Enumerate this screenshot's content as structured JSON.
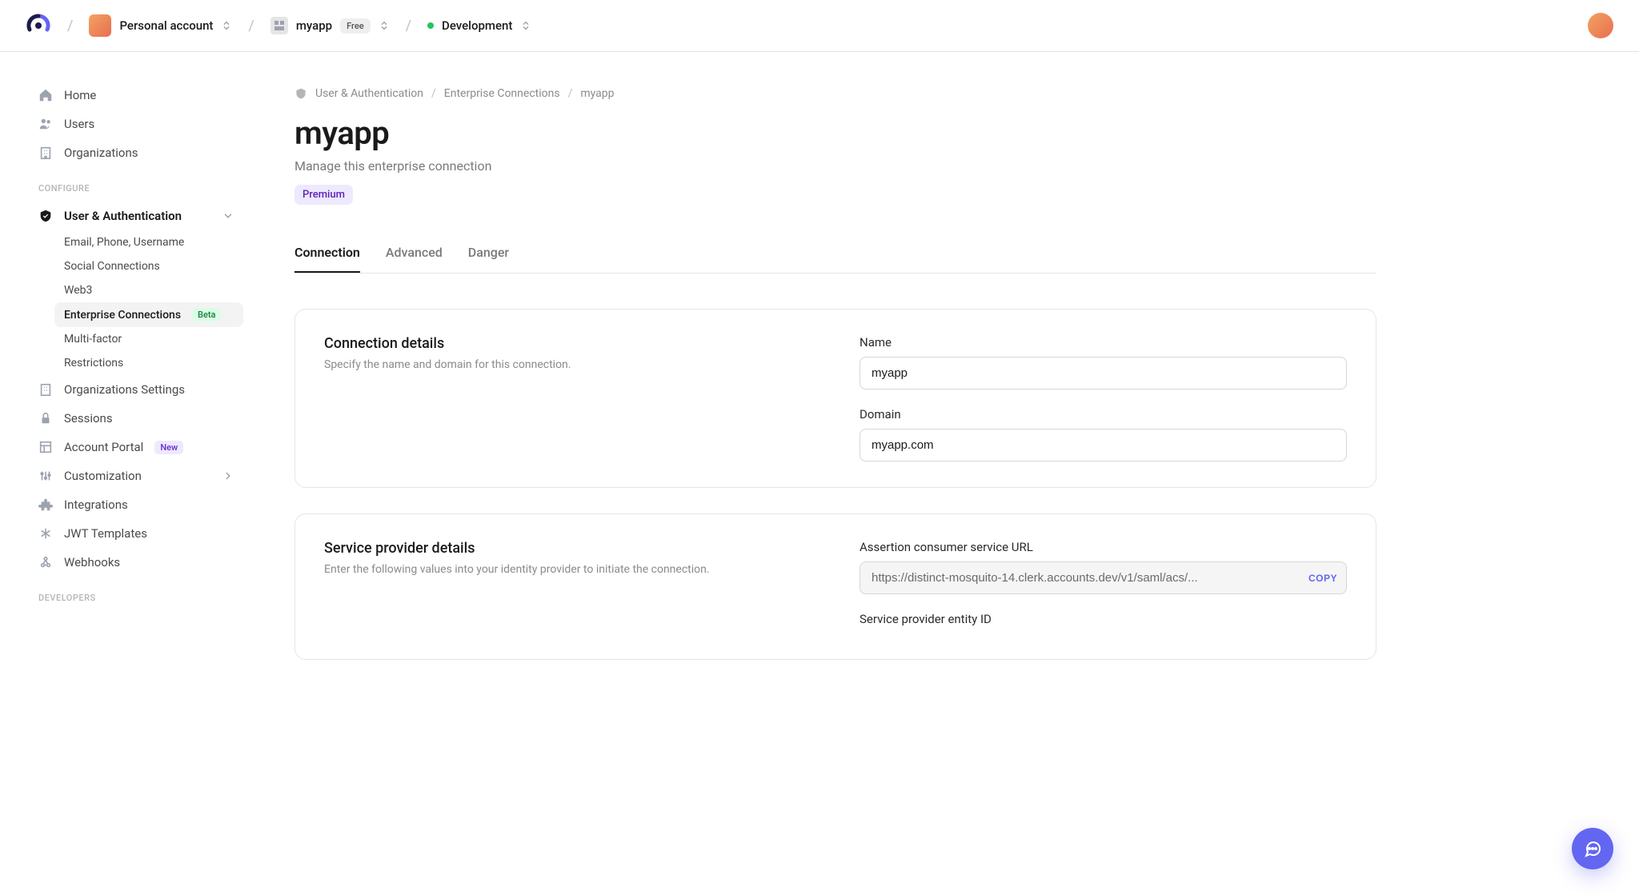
{
  "header": {
    "account": "Personal account",
    "app": "myapp",
    "app_badge": "Free",
    "env": "Development"
  },
  "sidebar": {
    "items_top": [
      {
        "label": "Home",
        "icon": "home"
      },
      {
        "label": "Users",
        "icon": "users"
      },
      {
        "label": "Organizations",
        "icon": "building"
      }
    ],
    "section_configure": "Configure",
    "user_auth": "User & Authentication",
    "user_auth_sub": [
      {
        "label": "Email, Phone, Username"
      },
      {
        "label": "Social Connections"
      },
      {
        "label": "Web3"
      },
      {
        "label": "Enterprise Connections",
        "badge": "Beta",
        "active": true
      },
      {
        "label": "Multi-factor"
      },
      {
        "label": "Restrictions"
      }
    ],
    "items_rest": [
      {
        "label": "Organizations Settings",
        "icon": "building"
      },
      {
        "label": "Sessions",
        "icon": "lock"
      },
      {
        "label": "Account Portal",
        "icon": "layout",
        "badge": "New"
      },
      {
        "label": "Customization",
        "icon": "sliders",
        "chev": true
      },
      {
        "label": "Integrations",
        "icon": "puzzle"
      },
      {
        "label": "JWT Templates",
        "icon": "asterisk"
      },
      {
        "label": "Webhooks",
        "icon": "webhook"
      }
    ],
    "section_developers": "Developers"
  },
  "breadcrumb": {
    "a": "User & Authentication",
    "b": "Enterprise Connections",
    "c": "myapp"
  },
  "page": {
    "title": "myapp",
    "subtitle": "Manage this enterprise connection",
    "badge": "Premium"
  },
  "tabs": [
    {
      "label": "Connection",
      "active": true
    },
    {
      "label": "Advanced"
    },
    {
      "label": "Danger"
    }
  ],
  "card_details": {
    "title": "Connection details",
    "desc": "Specify the name and domain for this connection.",
    "fields": {
      "name_label": "Name",
      "name_value": "myapp",
      "domain_label": "Domain",
      "domain_value": "myapp.com"
    }
  },
  "card_sp": {
    "title": "Service provider details",
    "desc": "Enter the following values into your identity provider to initiate the connection.",
    "acs_label": "Assertion consumer service URL",
    "acs_value": "https://distinct-mosquito-14.clerk.accounts.dev/v1/saml/acs/...",
    "copy": "COPY",
    "entity_label": "Service provider entity ID"
  }
}
